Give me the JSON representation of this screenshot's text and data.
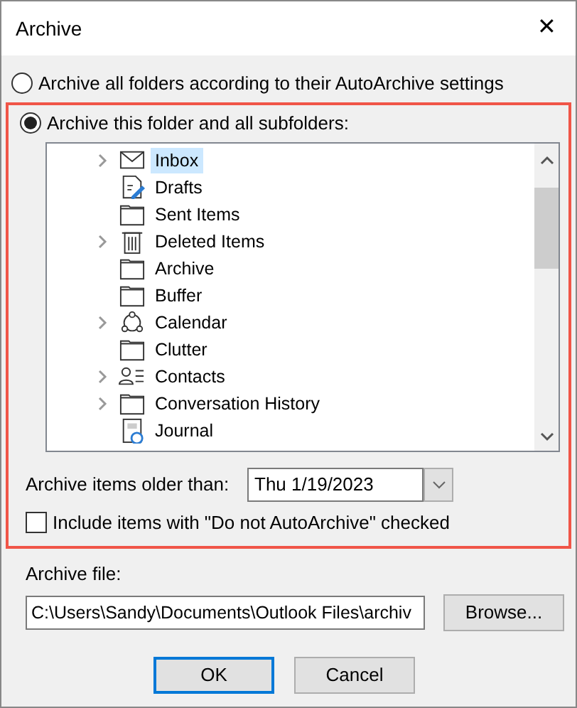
{
  "window": {
    "title": "Archive",
    "close": "✕"
  },
  "options": [
    {
      "label": "Archive all folders according to their AutoArchive settings",
      "selected": false
    },
    {
      "label": "Archive this folder and all subfolders:",
      "selected": true
    }
  ],
  "folders": [
    {
      "name": "Inbox",
      "kind": "mail",
      "expandable": true,
      "selected": true
    },
    {
      "name": "Drafts",
      "kind": "drafts",
      "expandable": false,
      "selected": false
    },
    {
      "name": "Sent Items",
      "kind": "folder",
      "expandable": false,
      "selected": false
    },
    {
      "name": "Deleted Items",
      "kind": "trash",
      "expandable": true,
      "selected": false
    },
    {
      "name": "Archive",
      "kind": "folder",
      "expandable": false,
      "selected": false
    },
    {
      "name": "Buffer",
      "kind": "folder",
      "expandable": false,
      "selected": false
    },
    {
      "name": "Calendar",
      "kind": "calendar",
      "expandable": true,
      "selected": false
    },
    {
      "name": "Clutter",
      "kind": "folder",
      "expandable": false,
      "selected": false
    },
    {
      "name": "Contacts",
      "kind": "contacts",
      "expandable": true,
      "selected": false
    },
    {
      "name": "Conversation History",
      "kind": "folder",
      "expandable": true,
      "selected": false
    },
    {
      "name": "Journal",
      "kind": "journal",
      "expandable": false,
      "selected": false
    }
  ],
  "older_than": {
    "label": "Archive items older than:",
    "value": "Thu 1/19/2023"
  },
  "include_checkbox": {
    "label": "Include items with \"Do not AutoArchive\" checked",
    "checked": false
  },
  "archive_file": {
    "label": "Archive file:",
    "value": "C:\\Users\\Sandy\\Documents\\Outlook Files\\archiv",
    "browse": "Browse..."
  },
  "buttons": [
    {
      "label": "OK",
      "default": true
    },
    {
      "label": "Cancel",
      "default": false
    }
  ]
}
